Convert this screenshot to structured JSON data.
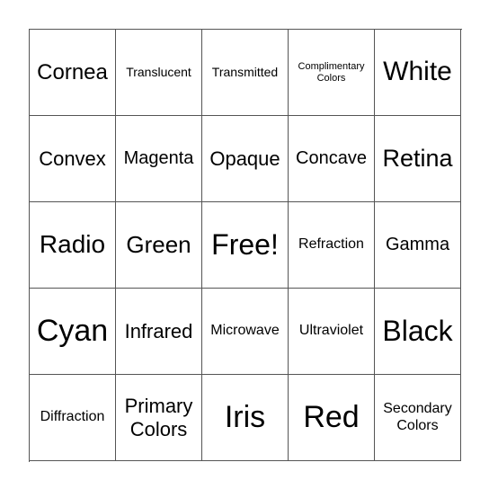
{
  "cells": [
    {
      "text": "Cornea",
      "size": 24
    },
    {
      "text": "Translucent",
      "size": 14
    },
    {
      "text": "Transmitted",
      "size": 14
    },
    {
      "text": "Complimentary Colors",
      "size": 11
    },
    {
      "text": "White",
      "size": 30
    },
    {
      "text": "Convex",
      "size": 22
    },
    {
      "text": "Magenta",
      "size": 20
    },
    {
      "text": "Opaque",
      "size": 22
    },
    {
      "text": "Concave",
      "size": 20
    },
    {
      "text": "Retina",
      "size": 27
    },
    {
      "text": "Radio",
      "size": 28
    },
    {
      "text": "Green",
      "size": 26
    },
    {
      "text": "Free!",
      "size": 32
    },
    {
      "text": "Refraction",
      "size": 16
    },
    {
      "text": "Gamma",
      "size": 20
    },
    {
      "text": "Cyan",
      "size": 34
    },
    {
      "text": "Infrared",
      "size": 22
    },
    {
      "text": "Microwave",
      "size": 16
    },
    {
      "text": "Ultraviolet",
      "size": 16
    },
    {
      "text": "Black",
      "size": 32
    },
    {
      "text": "Diffraction",
      "size": 16
    },
    {
      "text": "Primary Colors",
      "size": 22
    },
    {
      "text": "Iris",
      "size": 34
    },
    {
      "text": "Red",
      "size": 34
    },
    {
      "text": "Secondary Colors",
      "size": 16
    }
  ]
}
